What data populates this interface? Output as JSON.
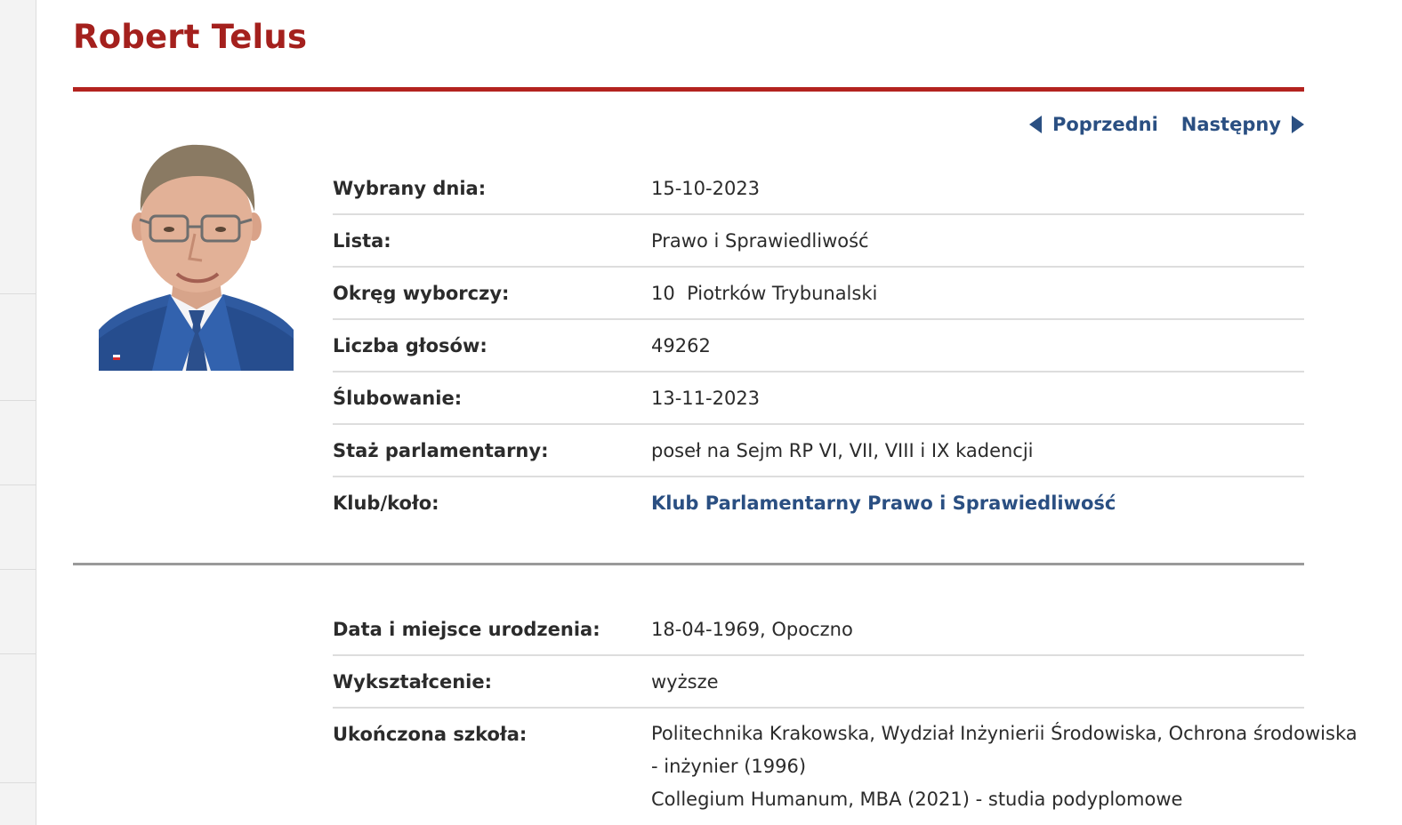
{
  "person": {
    "name": "Robert Telus"
  },
  "nav": {
    "prev_label": "Poprzedni",
    "next_label": "Następny"
  },
  "details": [
    {
      "label": "Wybrany dnia:",
      "value": "15-10-2023"
    },
    {
      "label": "Lista:",
      "value": "Prawo i Sprawiedliwość"
    },
    {
      "label": "Okręg wyborczy:",
      "value": "10  Piotrków Trybunalski"
    },
    {
      "label": "Liczba głosów:",
      "value": "49262"
    },
    {
      "label": "Ślubowanie:",
      "value": "13-11-2023"
    },
    {
      "label": "Staż parlamentarny:",
      "value": "poseł na Sejm RP VI, VII, VIII i IX kadencji"
    },
    {
      "label": "Klub/koło:",
      "value": "Klub Parlamentarny Prawo i Sprawiedliwość"
    }
  ],
  "bio": [
    {
      "label": "Data i miejsce urodzenia:",
      "value": "18-04-1969, Opoczno"
    },
    {
      "label": "Wykształcenie:",
      "value": "wyższe"
    },
    {
      "label": "Ukończona szkoła:",
      "lines": [
        "Politechnika Krakowska, Wydział Inżynierii Środowiska, Ochrona środowiska",
        "- inżynier (1996)",
        "Collegium Humanum, MBA (2021) - studia podyplomowe"
      ]
    }
  ],
  "colors": {
    "title": "#a4201d",
    "rule": "#b3231f",
    "link": "#2a4f82"
  }
}
